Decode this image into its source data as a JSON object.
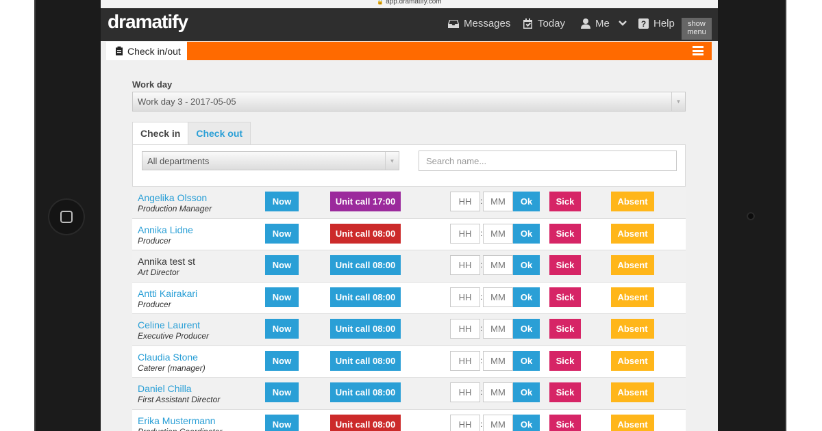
{
  "browser": {
    "url": "app.dramatify.com"
  },
  "app": {
    "logo": "dramatify"
  },
  "nav": {
    "messages": "Messages",
    "today": "Today",
    "me": "Me",
    "help": "Help",
    "show_menu_line1": "show",
    "show_menu_line2": "menu"
  },
  "page": {
    "tab_title": "Check in/out"
  },
  "work_day": {
    "label": "Work day",
    "selected": "Work day 3 - 2017-05-05"
  },
  "tabs": {
    "check_in": "Check in",
    "check_out": "Check out"
  },
  "filters": {
    "department": "All departments",
    "search_placeholder": "Search name..."
  },
  "labels": {
    "now": "Now",
    "hh": "HH",
    "mm": "MM",
    "ok": "Ok",
    "sick": "Sick",
    "absent": "Absent"
  },
  "colors": {
    "brand_orange": "#ff6a00",
    "primary_blue": "#2a9fd6",
    "call_red": "#cc2a2a",
    "call_purple": "#9b2a9c",
    "sick_pink": "#d62566",
    "absent_yellow": "#ffb61a"
  },
  "people": [
    {
      "name": "Angelika Olsson",
      "role": "Production Manager",
      "unit_call": "Unit call 17:00",
      "call_status": "purple",
      "linked": true
    },
    {
      "name": "Annika Lidne",
      "role": "Producer",
      "unit_call": "Unit call 08:00",
      "call_status": "red",
      "linked": true
    },
    {
      "name": "Annika test st",
      "role": "Art Director",
      "unit_call": "Unit call 08:00",
      "call_status": "blue",
      "linked": false
    },
    {
      "name": "Antti Kairakari",
      "role": "Producer",
      "unit_call": "Unit call 08:00",
      "call_status": "blue",
      "linked": true
    },
    {
      "name": "Celine Laurent",
      "role": "Executive Producer",
      "unit_call": "Unit call 08:00",
      "call_status": "blue",
      "linked": true
    },
    {
      "name": "Claudia Stone",
      "role": "Caterer (manager)",
      "unit_call": "Unit call 08:00",
      "call_status": "blue",
      "linked": true
    },
    {
      "name": "Daniel Chilla",
      "role": "First Assistant Director",
      "unit_call": "Unit call 08:00",
      "call_status": "blue",
      "linked": true
    },
    {
      "name": "Erika Mustermann",
      "role": "Production Coordinator",
      "unit_call": "Unit call 08:00",
      "call_status": "red",
      "linked": true
    }
  ]
}
